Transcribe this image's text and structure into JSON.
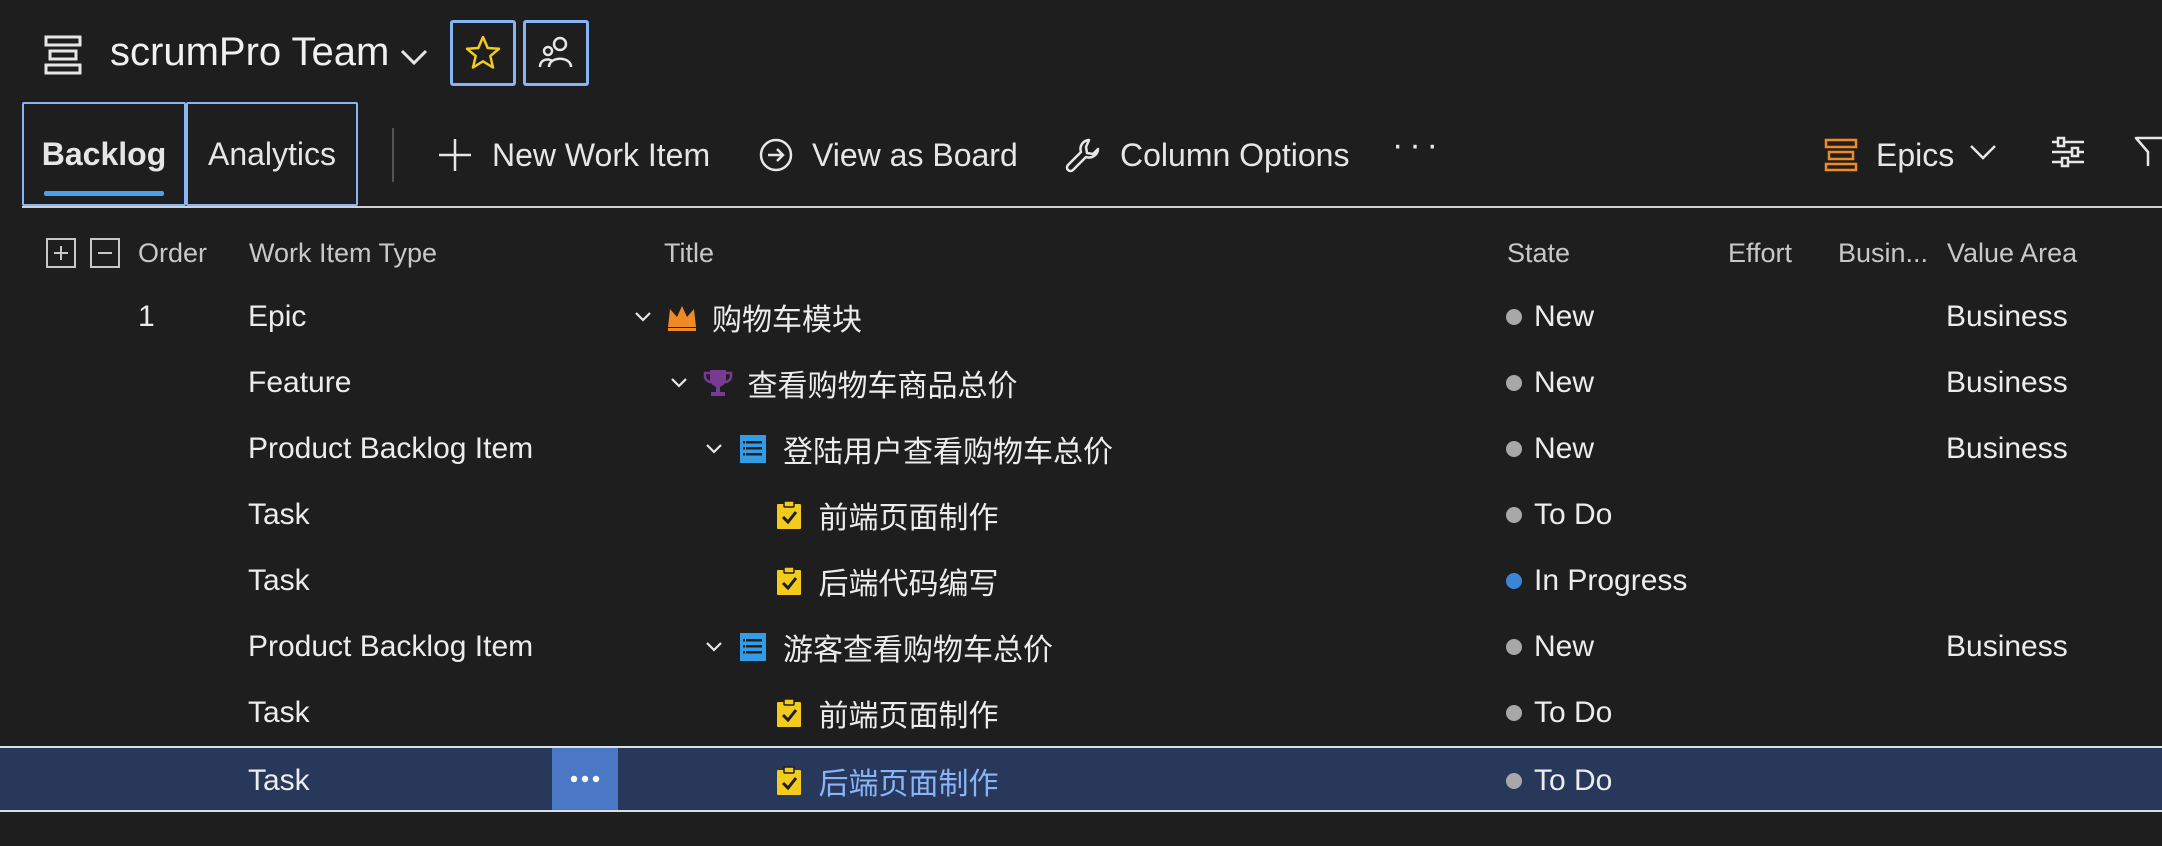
{
  "header": {
    "team_name": "scrumPro Team"
  },
  "toolbar": {
    "tabs": [
      {
        "label": "Backlog",
        "selected": true
      },
      {
        "label": "Analytics",
        "selected": false
      }
    ],
    "new_work_item": "New Work Item",
    "view_as_board": "View as Board",
    "column_options": "Column Options",
    "more": "···",
    "level": "Epics"
  },
  "columns": {
    "order": "Order",
    "work_item_type": "Work Item Type",
    "title": "Title",
    "state": "State",
    "effort": "Effort",
    "business_value": "Busin...",
    "value_area": "Value Area"
  },
  "rows": [
    {
      "order": "1",
      "type": "Epic",
      "title": "购物车模块",
      "state": "New",
      "value_area": "Business",
      "icon": "crown-icon",
      "level": 0,
      "expanded": true
    },
    {
      "order": "",
      "type": "Feature",
      "title": "查看购物车商品总价",
      "state": "New",
      "value_area": "Business",
      "icon": "trophy-icon",
      "level": 1,
      "expanded": true
    },
    {
      "order": "",
      "type": "Product Backlog Item",
      "title": "登陆用户查看购物车总价",
      "state": "New",
      "value_area": "Business",
      "icon": "pbi-icon",
      "level": 2,
      "expanded": true
    },
    {
      "order": "",
      "type": "Task",
      "title": "前端页面制作",
      "state": "To Do",
      "value_area": "",
      "icon": "task-icon",
      "level": 3
    },
    {
      "order": "",
      "type": "Task",
      "title": "后端代码编写",
      "state": "In Progress",
      "value_area": "",
      "icon": "task-icon",
      "level": 3
    },
    {
      "order": "",
      "type": "Product Backlog Item",
      "title": "游客查看购物车总价",
      "state": "New",
      "value_area": "Business",
      "icon": "pbi-icon",
      "level": 2,
      "expanded": true
    },
    {
      "order": "",
      "type": "Task",
      "title": "前端页面制作",
      "state": "To Do",
      "value_area": "",
      "icon": "task-icon",
      "level": 3
    },
    {
      "order": "",
      "type": "Task",
      "title": "后端页面制作",
      "state": "To Do",
      "value_area": "",
      "icon": "task-icon",
      "level": 3,
      "selected": true
    }
  ],
  "colors": {
    "accent": "#8ab4f8",
    "epic": "#f08a24",
    "feature": "#773b93",
    "pbi": "#339ce6",
    "task": "#f2cb1d",
    "state_new": "#a8a8a8",
    "state_in_progress": "#3b85d9"
  }
}
